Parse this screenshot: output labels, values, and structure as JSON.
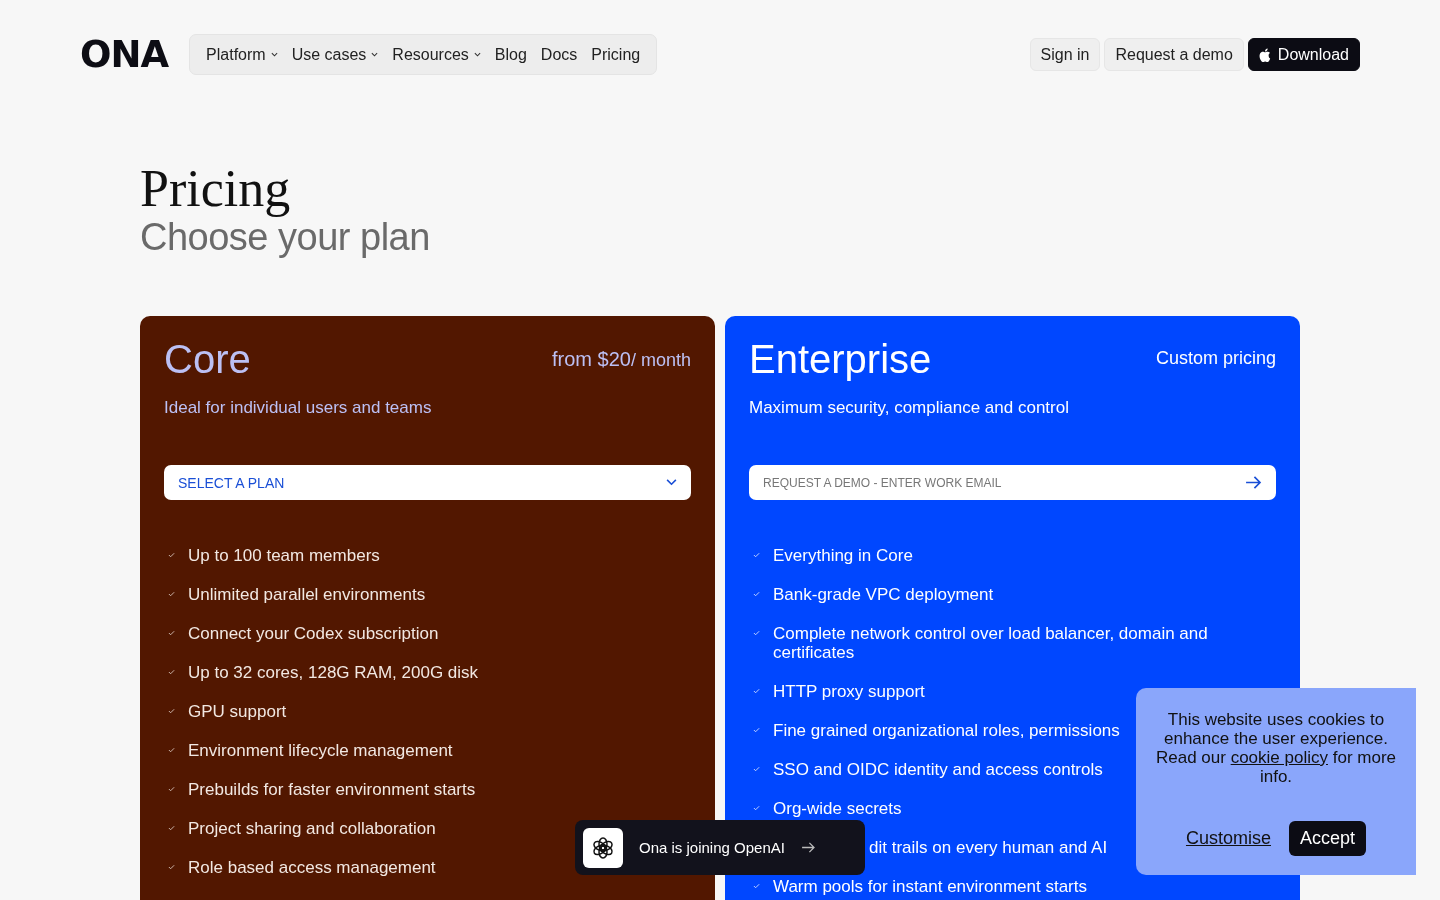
{
  "header": {
    "logo": "ONA",
    "nav": [
      {
        "label": "Platform",
        "kind": "menu"
      },
      {
        "label": "Use cases",
        "kind": "menu"
      },
      {
        "label": "Resources",
        "kind": "menu"
      },
      {
        "label": "Blog",
        "kind": "link"
      },
      {
        "label": "Docs",
        "kind": "link"
      },
      {
        "label": "Pricing",
        "kind": "link"
      }
    ],
    "actions": [
      {
        "label": "Sign in",
        "kind": "plain"
      },
      {
        "label": "Request a demo",
        "kind": "plain"
      },
      {
        "label": "Download",
        "kind": "primary"
      }
    ]
  },
  "page": {
    "title": "Pricing",
    "subtitle": "Choose your plan"
  },
  "plans": [
    {
      "name": "Core",
      "price": "from $20",
      "price_unit": "/ month",
      "description": "Ideal for individual users and teams",
      "field": {
        "kind": "select",
        "value": "SELECT A PLAN"
      },
      "features": [
        {
          "text": "Up to 100 team members",
          "kind": "full"
        },
        {
          "text": "Unlimited parallel environments",
          "kind": "full"
        },
        {
          "text": "Connect your Codex subscription",
          "kind": "full"
        },
        {
          "text": "Up to 32 cores, 128G RAM, 200G disk",
          "kind": "full"
        },
        {
          "text": "GPU support",
          "kind": "full"
        },
        {
          "text": "Environment lifecycle management",
          "kind": "full"
        },
        {
          "text": "Prebuilds for faster environment starts",
          "kind": "full"
        },
        {
          "text": "Project sharing and collaboration",
          "kind": "full"
        },
        {
          "text": "Role based access management",
          "kind": "full"
        }
      ]
    },
    {
      "name": "Enterprise",
      "price": "Custom pricing",
      "description": "Maximum security, compliance and control",
      "field": {
        "kind": "email",
        "placeholder": "REQUEST A DEMO - ENTER WORK EMAIL"
      },
      "features": [
        {
          "text": "Everything in Core",
          "kind": "full"
        },
        {
          "text": "Bank-grade VPC deployment",
          "kind": "full"
        },
        {
          "text": "Complete network control over load balancer, domain and certificates",
          "kind": "full"
        },
        {
          "text": "HTTP proxy support",
          "kind": "full"
        },
        {
          "text": "Fine grained organizational roles, permissions",
          "kind": "full"
        },
        {
          "text": "SSO and OIDC identity and access controls",
          "kind": "full"
        },
        {
          "text": "Org-wide secrets",
          "kind": "full"
        },
        {
          "text": "dit trails on every human and AI",
          "kind": "covered"
        },
        {
          "text": "Warm pools for instant environment starts",
          "kind": "full"
        }
      ]
    }
  ],
  "toast": {
    "text": "Ona is joining OpenAI"
  },
  "cookie_banner": {
    "text_before": "This website uses cookies to enhance the user experience. Read our",
    "link": "cookie policy",
    "text_after": "for more info.",
    "buttons": [
      {
        "label": "Customise",
        "kind": "link"
      },
      {
        "label": "Accept",
        "kind": "primary"
      }
    ]
  }
}
